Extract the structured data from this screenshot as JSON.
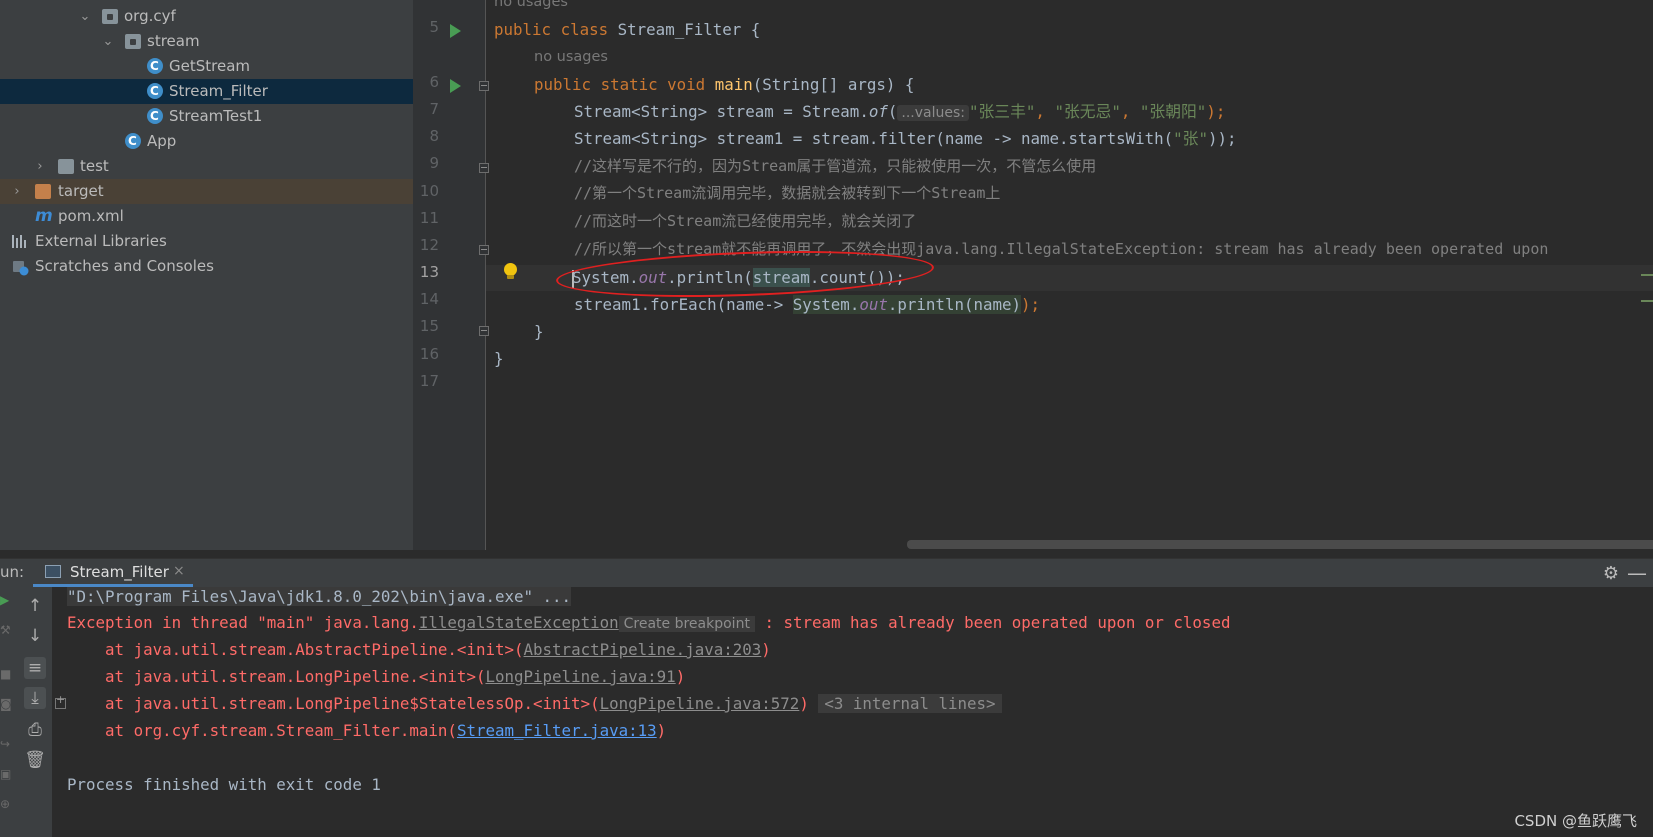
{
  "project_tree": {
    "items": [
      {
        "label": "org.cyf",
        "kind": "package"
      },
      {
        "label": "stream",
        "kind": "package"
      },
      {
        "label": "GetStream",
        "kind": "class"
      },
      {
        "label": "Stream_Filter",
        "kind": "class",
        "selected": true
      },
      {
        "label": "StreamTest1",
        "kind": "class"
      },
      {
        "label": "App",
        "kind": "class"
      },
      {
        "label": "test",
        "kind": "folder"
      },
      {
        "label": "target",
        "kind": "folder-excluded"
      },
      {
        "label": "pom.xml",
        "kind": "maven-file"
      },
      {
        "label": "External Libraries",
        "kind": "libraries"
      },
      {
        "label": "Scratches and Consoles",
        "kind": "scratches"
      }
    ]
  },
  "editor": {
    "current_line": "13",
    "hints": {
      "top_usage": "no usages",
      "main_usage": "no usages",
      "of_param": "...values:"
    },
    "lines": {
      "l5": {
        "num": "5",
        "kw": "public class ",
        "name": "Stream_Filter",
        "rest": " {"
      },
      "l6": {
        "num": "6",
        "kw": "public static void ",
        "fn": "main",
        "rest": "(String[] args) {"
      },
      "l7": {
        "num": "7",
        "a": "Stream<String> stream = Stream.",
        "b": "of",
        "c": "(",
        "s1": "\"张三丰\"",
        "sep1": ", ",
        "s2": "\"张无忌\"",
        "sep2": ", ",
        "s3": "\"张朝阳\"",
        "d": ");"
      },
      "l8": {
        "num": "8",
        "a": "Stream<String> stream1 = stream.filter(name -> name.startsWith(",
        "s": "\"张\"",
        "b": "));"
      },
      "l9": {
        "num": "9",
        "text": "//这样写是不行的，因为Stream属于管道流，只能被使用一次，不管怎么使用"
      },
      "l10": {
        "num": "10",
        "text": "//第一个Stream流调用完毕，数据就会被转到下一个Stream上"
      },
      "l11": {
        "num": "11",
        "text": "//而这时一个Stream流已经使用完毕，就会关闭了"
      },
      "l12": {
        "num": "12",
        "text": "//所以第一个stream就不能再调用了，不然会出现java.lang.IllegalStateException: stream has already been operated upon"
      },
      "l13": {
        "num": "13",
        "a": "System.",
        "b": "out",
        "c": ".println(",
        "d": "stream",
        "e": ".count());"
      },
      "l14": {
        "num": "14",
        "a": "stream1.forEach(name-> ",
        "b": "System.",
        "c": "out",
        "d": ".println(name)",
        "e": ");"
      },
      "l15": {
        "num": "15",
        "text": "}"
      },
      "l16": {
        "num": "16",
        "text": "}"
      },
      "l17": {
        "num": "17",
        "text": ""
      }
    }
  },
  "run_panel": {
    "label": "un:",
    "tab_label": "Stream_Filter",
    "console": {
      "cmd": "\"D:\\Program Files\\Java\\jdk1.8.0_202\\bin\\java.exe\" ...",
      "exc_prefix": "Exception in thread \"main\" java.lang.",
      "exc_class": "IllegalStateException",
      "breakpoint_hint": "Create breakpoint",
      "exc_msg": " : stream has already been operated upon or closed",
      "trace1_a": "    at java.util.stream.AbstractPipeline.<init>(",
      "trace1_link": "AbstractPipeline.java:203",
      "trace2_a": "    at java.util.stream.LongPipeline.<init>(",
      "trace2_link": "LongPipeline.java:91",
      "trace3_a": "    at java.util.stream.LongPipeline$StatelessOp.<init>(",
      "trace3_link": "LongPipeline.java:572",
      "internal_lines": "<3 internal lines>",
      "trace4_a": "    at org.cyf.stream.Stream_Filter.main(",
      "trace4_link": "Stream_Filter.java:13",
      "close_paren": ")",
      "finished": "Process finished with exit code 1"
    }
  },
  "watermark": "CSDN @鱼跃鹰飞",
  "colors": {
    "keyword": "#cc7832",
    "method": "#ffc66d",
    "string": "#6a8759",
    "comment": "#808080",
    "error": "#ff6b68",
    "annotation_circle": "#e02020"
  }
}
